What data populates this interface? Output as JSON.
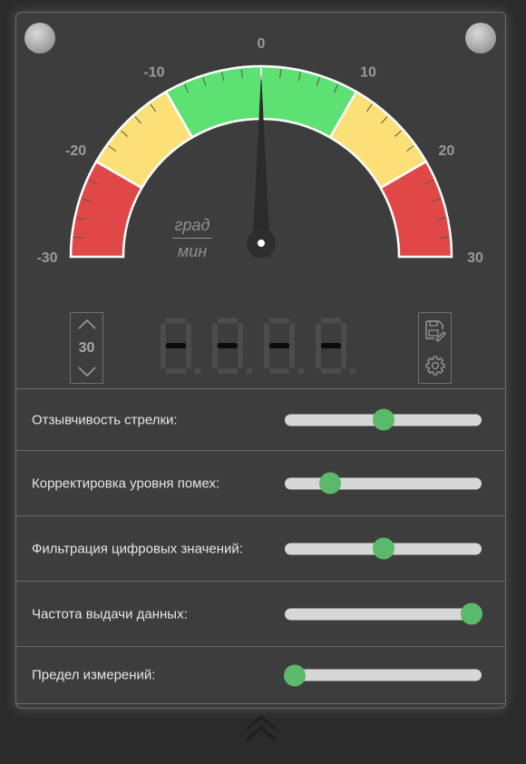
{
  "gauge": {
    "tick_labels": [
      "-30",
      "-20",
      "-10",
      "0",
      "10",
      "20",
      "30"
    ],
    "min": -30,
    "max": 30,
    "needle_value": 0,
    "zones": [
      {
        "from": -30,
        "to": -20,
        "color": "#e04848"
      },
      {
        "from": -20,
        "to": -10,
        "color": "#fbe078"
      },
      {
        "from": -10,
        "to": 10,
        "color": "#5de173"
      },
      {
        "from": 10,
        "to": 20,
        "color": "#fbe078"
      },
      {
        "from": 20,
        "to": 30,
        "color": "#e04848"
      }
    ],
    "unit_numerator": "град",
    "unit_denominator": "мин"
  },
  "range_stepper": {
    "value": "30",
    "up_icon": "chevron-up-icon",
    "down_icon": "chevron-down-icon"
  },
  "display": {
    "digits": [
      "-",
      "-",
      "-",
      "-"
    ]
  },
  "tools": {
    "save_icon": "save-edit-icon",
    "settings_icon": "gear-icon"
  },
  "settings": [
    {
      "label": "Отзывчивость стрелки:",
      "value": 0.5
    },
    {
      "label": "Корректировка уровня помех:",
      "value": 0.23
    },
    {
      "label": "Фильтрация цифровых значений:",
      "value": 0.5
    },
    {
      "label": "Частота выдачи данных:",
      "value": 0.95
    },
    {
      "label": "Предел измерений:",
      "value": 0.05
    }
  ],
  "colors": {
    "accent": "#5ab96a",
    "panel": "#3d3d3d",
    "background": "#2b2b2b"
  },
  "collapse_icon": "double-chevron-up-icon"
}
